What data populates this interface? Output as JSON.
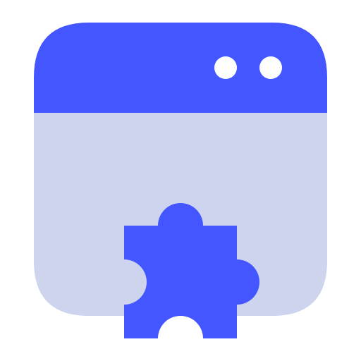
{
  "icon": {
    "name": "browser-extension-icon",
    "colors": {
      "accent": "#4356FF",
      "window_body": "#CED4EE",
      "window_dot": "#FFFFFF",
      "background": "#FFFFFF"
    },
    "window_dots": 2,
    "parts": [
      "window-titlebar",
      "window-body",
      "window-dots",
      "puzzle-piece"
    ]
  }
}
